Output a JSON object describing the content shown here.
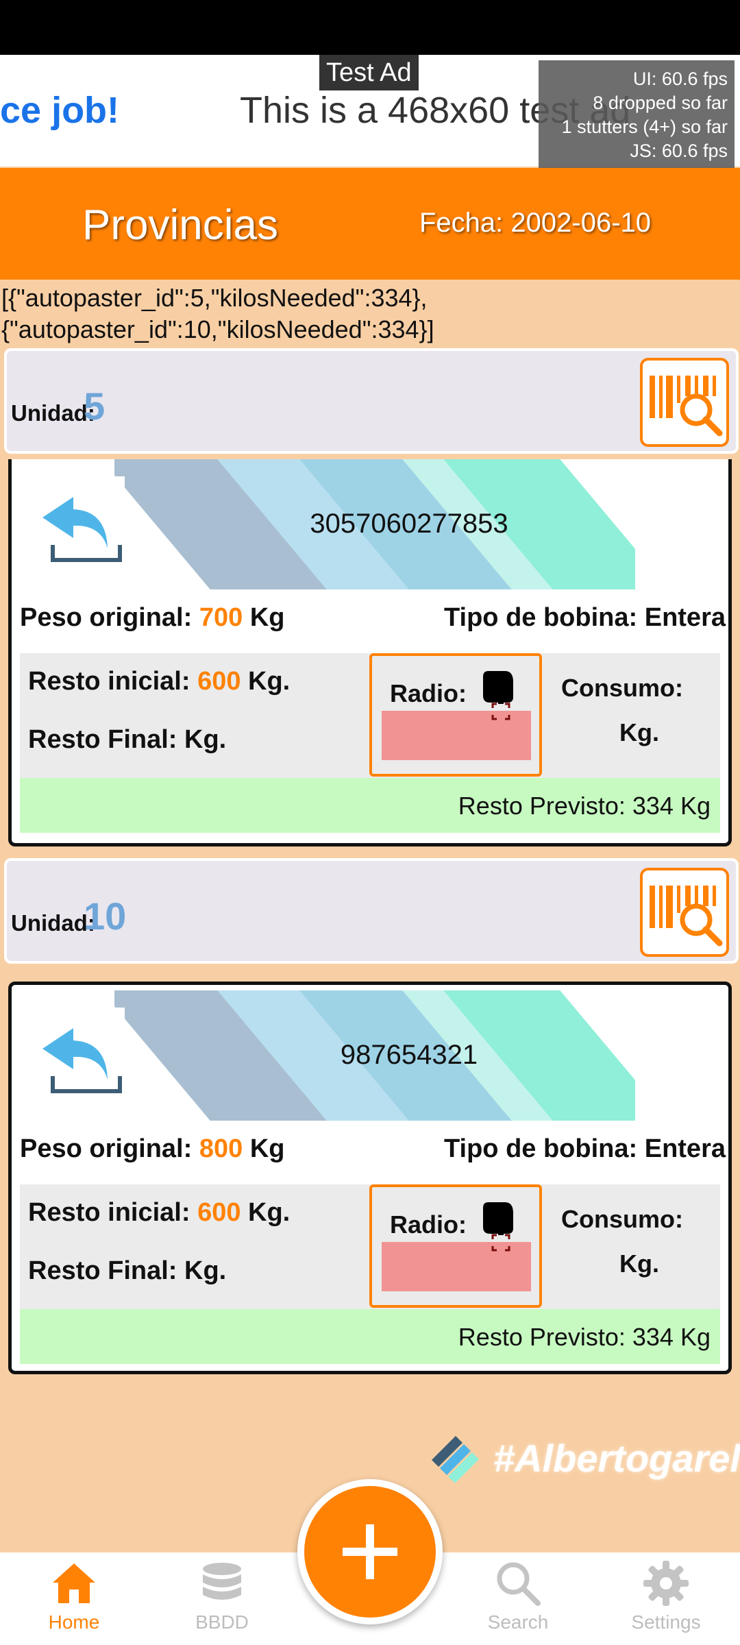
{
  "ad": {
    "label": "Test Ad",
    "left_text": "ce job!",
    "main_text": "This is a 468x60 test ad"
  },
  "fps": {
    "ui": "UI: 60.6 fps",
    "dropped": "8 dropped so far",
    "stutters": "1 stutters (4+) so far",
    "js": "JS: 60.6 fps"
  },
  "header": {
    "title": "Provincias",
    "date": "Fecha: 2002-06-10"
  },
  "json_line": "[{\"autopaster_id\":5,\"kilosNeeded\":334},{\"autopaster_id\":10,\"kilosNeeded\":334}]",
  "units": [
    {
      "unit_label": "Unidad:",
      "unit_number": "5",
      "card_id": "3057060277853",
      "peso_label": "Peso original:",
      "peso_value": "700",
      "peso_unit": "Kg",
      "tipo": "Tipo de bobina: Entera",
      "resto_ini_label": "Resto inicial:",
      "resto_ini_value": "600",
      "resto_ini_unit": "Kg.",
      "resto_fin": "Resto Final:  Kg.",
      "radio_label": "Radio:",
      "consumo_label": "Consumo:",
      "consumo_unit": "Kg.",
      "resto_previsto": "Resto Previsto: 334 Kg"
    },
    {
      "unit_label": "Unidad:",
      "unit_number": "10",
      "card_id": "987654321",
      "peso_label": "Peso original:",
      "peso_value": "800",
      "peso_unit": "Kg",
      "tipo": "Tipo de bobina: Entera",
      "resto_ini_label": "Resto inicial:",
      "resto_ini_value": "600",
      "resto_ini_unit": "Kg.",
      "resto_fin": "Resto Final:  Kg.",
      "radio_label": "Radio:",
      "consumo_label": "Consumo:",
      "consumo_unit": "Kg.",
      "resto_previsto": "Resto Previsto: 334 Kg"
    }
  ],
  "watermark": "#Albertogarel",
  "nav": {
    "home": "Home",
    "bbdd": "BBDD",
    "search": "Search",
    "settings": "Settings"
  },
  "colors": {
    "accent": "#ff8205",
    "unit_number": "#6fa5d8",
    "radio_input": "#f29393",
    "resto_previsto_bg": "#c7fac1"
  }
}
